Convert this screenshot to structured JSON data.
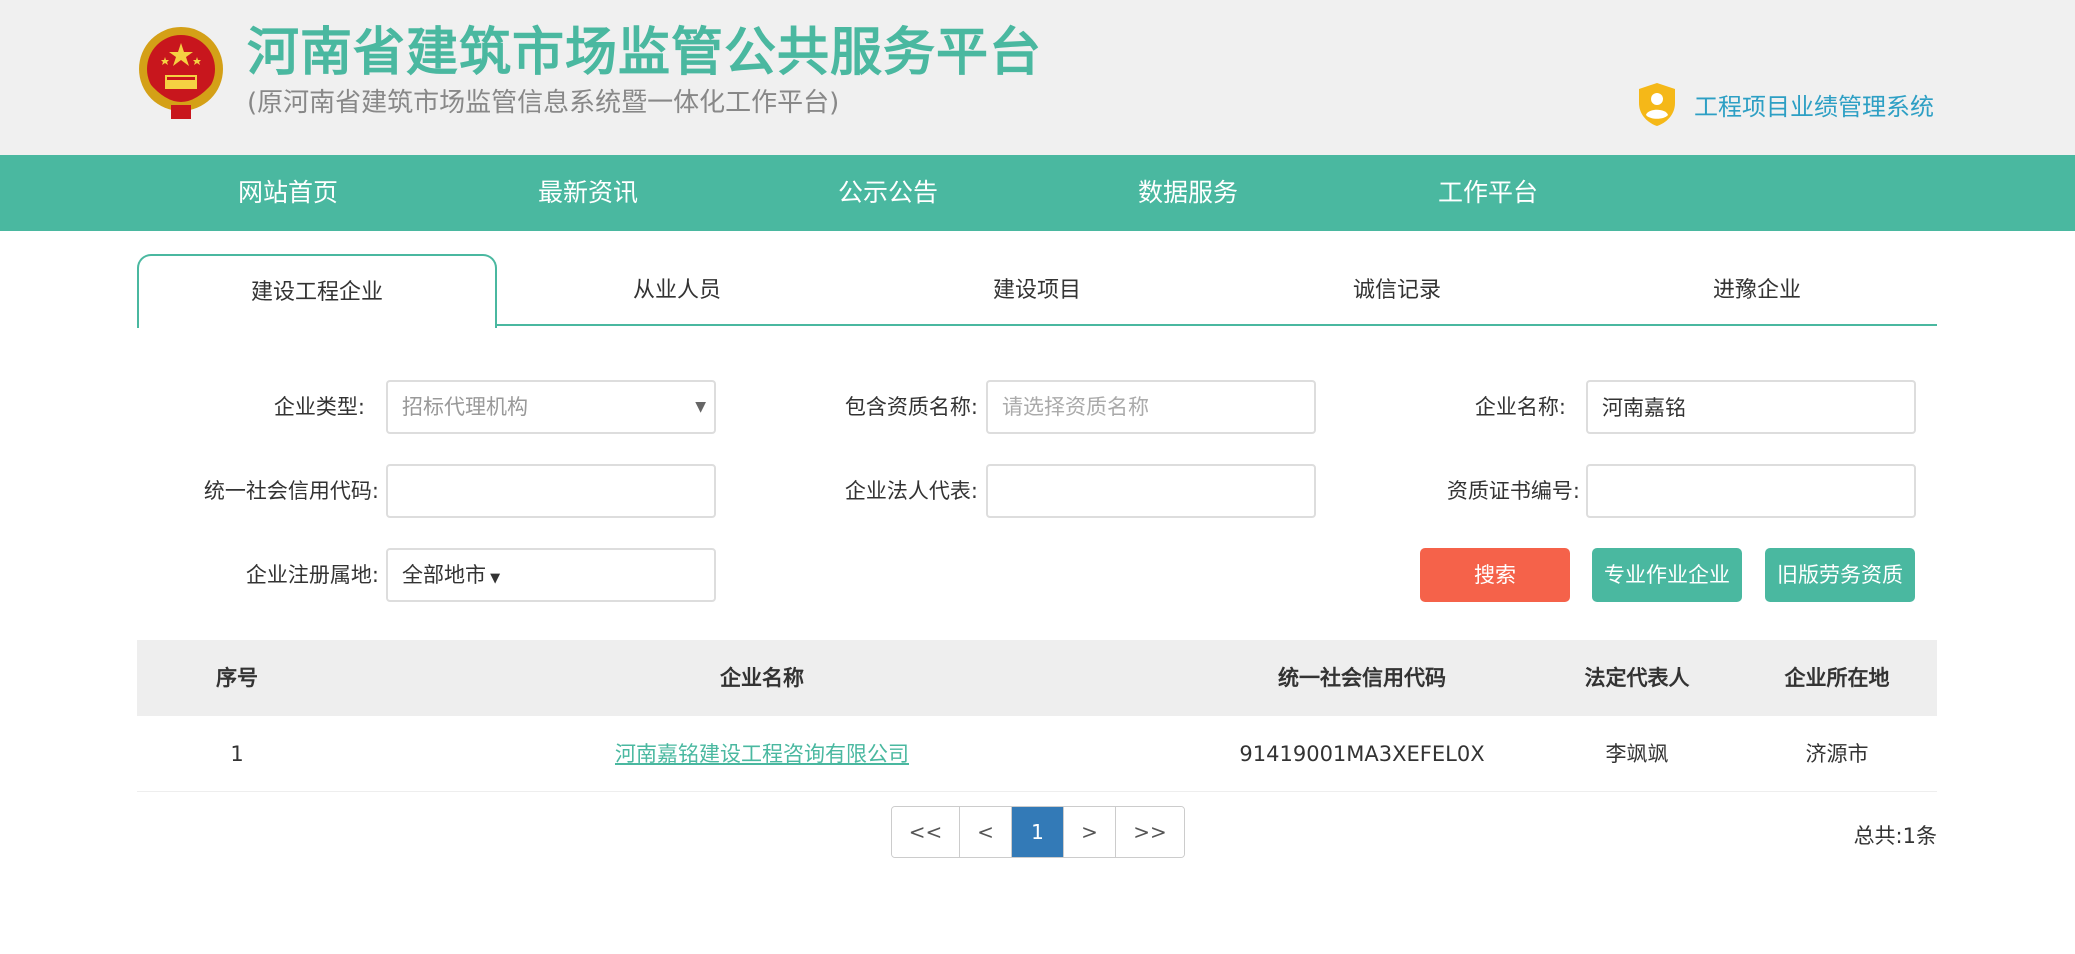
{
  "header": {
    "title": "河南省建筑市场监管公共服务平台",
    "subtitle": "(原河南省建筑市场监管信息系统暨一体化工作平台)",
    "perf_link": "工程项目业绩管理系统"
  },
  "nav": {
    "items": [
      "网站首页",
      "最新资讯",
      "公示公告",
      "数据服务",
      "工作平台"
    ]
  },
  "tabs": {
    "items": [
      "建设工程企业",
      "从业人员",
      "建设项目",
      "诚信记录",
      "进豫企业"
    ]
  },
  "form": {
    "enterprise_type_label": "企业类型:",
    "enterprise_type_value": "招标代理机构",
    "qualification_label": "包含资质名称:",
    "qualification_placeholder": "请选择资质名称",
    "enterprise_name_label": "企业名称:",
    "enterprise_name_value": "河南嘉铭",
    "credit_code_label": "统一社会信用代码:",
    "credit_code_value": "",
    "legal_rep_label": "企业法人代表:",
    "legal_rep_value": "",
    "cert_no_label": "资质证书编号:",
    "cert_no_value": "",
    "region_label": "企业注册属地:",
    "region_value": "全部地市",
    "search_button": "搜索",
    "specialized_button": "专业作业企业",
    "old_labor_button": "旧版劳务资质"
  },
  "table": {
    "headers": [
      "序号",
      "企业名称",
      "统一社会信用代码",
      "法定代表人",
      "企业所在地"
    ],
    "rows": [
      {
        "index": "1",
        "name": "河南嘉铭建设工程咨询有限公司",
        "credit_code": "91419001MA3XEFEL0X",
        "legal_rep": "李飒飒",
        "location": "济源市"
      }
    ]
  },
  "pagination": {
    "first": "<<",
    "prev": "<",
    "current": "1",
    "next": ">",
    "last": ">>",
    "total": "总共:1条"
  },
  "colors": {
    "brand": "#4ab8a0",
    "search": "#f5624a",
    "link": "#2d9fc4",
    "page_active": "#337ab7"
  }
}
